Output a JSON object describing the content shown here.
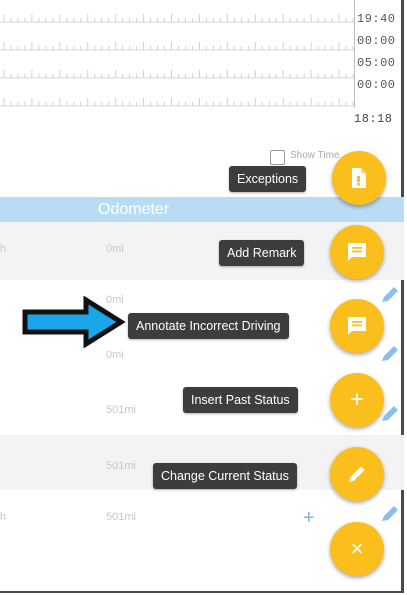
{
  "times": [
    "19:40",
    "00:00",
    "05:00",
    "00:00"
  ],
  "current_time": "18:18",
  "checkbox_label": "Show Time",
  "table": {
    "header_odometer": "Odometer",
    "rows": [
      {
        "edge": "h",
        "odometer": "0mi"
      },
      {
        "edge": "",
        "odometer": "0mi"
      },
      {
        "edge": "",
        "odometer": "0mi"
      },
      {
        "edge": "",
        "odometer": "501mi"
      },
      {
        "edge": "",
        "odometer": "501mi"
      },
      {
        "edge": "h",
        "odometer": "501mi"
      }
    ],
    "add_symbol": "+"
  },
  "fab_menu": {
    "exceptions": "Exceptions",
    "add_remark": "Add Remark",
    "annotate": "Annotate Incorrect Driving",
    "insert_past": "Insert Past Status",
    "change_current": "Change Current Status",
    "close_symbol": "×",
    "plus_symbol": "+"
  },
  "colors": {
    "fab": "#fbbf1d",
    "header_band": "#b9dcf5",
    "tooltip": "#3d3d3d",
    "arrow_fill": "#1aa6e8"
  },
  "icons": {
    "exceptions": "document-icon",
    "add_remark": "comment-icon",
    "annotate": "comment-icon",
    "insert_past": "plus-icon",
    "change_current": "pencil-icon",
    "close": "close-icon",
    "pointer": "arrow-right-icon",
    "row_edit": "pencil-icon"
  }
}
